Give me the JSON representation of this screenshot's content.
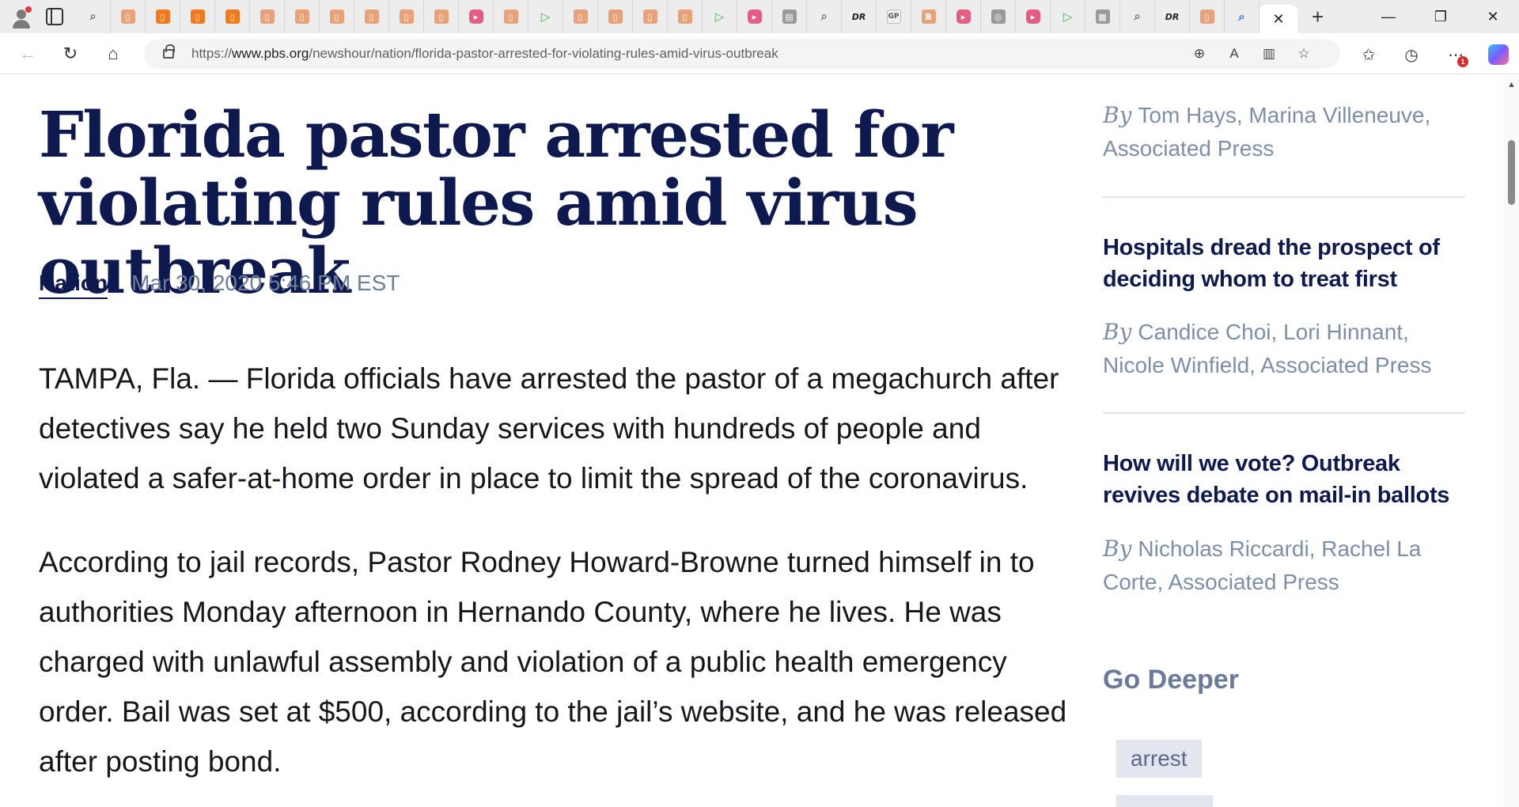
{
  "browser": {
    "url_prefix": "https://",
    "url_domain": "www.pbs.org",
    "url_path": "/newshour/nation/florida-pastor-arrested-for-violating-rules-amid-virus-outbreak",
    "active_tab_close": "✕",
    "new_tab": "+",
    "window_controls": {
      "minimize": "—",
      "restore": "❐",
      "close": "✕"
    },
    "notification_badge": "1"
  },
  "article": {
    "headline": "Florida pastor arrested for violating rules amid virus outbreak",
    "category": "Nation",
    "date": "Mar 30, 2020 5:46 PM EST",
    "paragraphs": [
      "TAMPA, Fla. — Florida officials have arrested the pastor of a megachurch after detectives say he held two Sunday services with hundreds of people and violated a safer-at-home order in place to limit the spread of the coronavirus.",
      "According to jail records, Pastor Rodney Howard-Browne turned himself in to authorities Monday afternoon in Hernando County, where he lives. He was charged with unlawful assembly and violation of a public health emergency order. Bail was set at $500, according to the jail’s website, and he was released after posting bond."
    ]
  },
  "sidebar": {
    "by_label": "By",
    "first_byline": "Tom Hays, Marina Villeneuve, Associated Press",
    "stories": [
      {
        "title": "Hospitals dread the prospect of deciding whom to treat first",
        "byline": "Candice Choi, Lori Hinnant, Nicole Winfield, Associated Press"
      },
      {
        "title": "How will we vote? Outbreak revives debate on mail-in ballots",
        "byline": "Nicholas Riccardi, Rachel La Corte, Associated Press"
      }
    ],
    "go_deeper": "Go Deeper",
    "tags": [
      "arrest"
    ]
  }
}
